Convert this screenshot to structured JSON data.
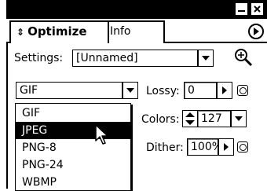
{
  "tabs": {
    "optimize": "Optimize",
    "info": "Info",
    "optimize_arrow": "⇕"
  },
  "settings": {
    "label": "Settings:",
    "value": "[Unnamed]"
  },
  "format": {
    "value": "GIF",
    "options": [
      "GIF",
      "JPEG",
      "PNG-8",
      "PNG-24",
      "WBMP"
    ],
    "highlighted": "JPEG"
  },
  "lossy": {
    "label": "Lossy:",
    "value": "0"
  },
  "colors": {
    "label": "Colors:",
    "value": "127"
  },
  "dither": {
    "label": "Dither:",
    "value": "100%"
  },
  "icons": [
    "collapse-icon",
    "close-icon",
    "panel-menu-arrow-icon",
    "optimize-wand-icon",
    "chevron-down-icon",
    "chevron-right-icon",
    "stepper-icon",
    "mask-ring-icon",
    "cursor-arrow-icon"
  ]
}
